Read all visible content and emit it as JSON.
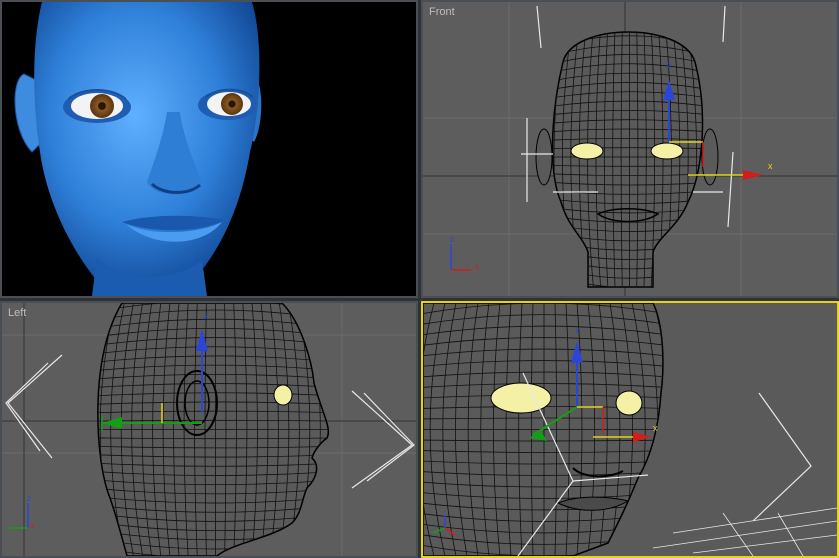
{
  "viewports": {
    "front": {
      "label": "Front"
    },
    "left": {
      "label": "Left"
    }
  },
  "gizmo": {
    "x_label": "x",
    "y_label": "y",
    "z_label": "z"
  },
  "colors": {
    "active_border": "#e6d21b",
    "skin_blue": "#3a8be0",
    "viewport_gray": "#5d5d5d",
    "mesh_line": "#111111",
    "eye_fill": "#f4f0a6",
    "axis_x": "#d61b1b",
    "axis_y": "#12a012",
    "axis_z": "#2a46d8"
  }
}
